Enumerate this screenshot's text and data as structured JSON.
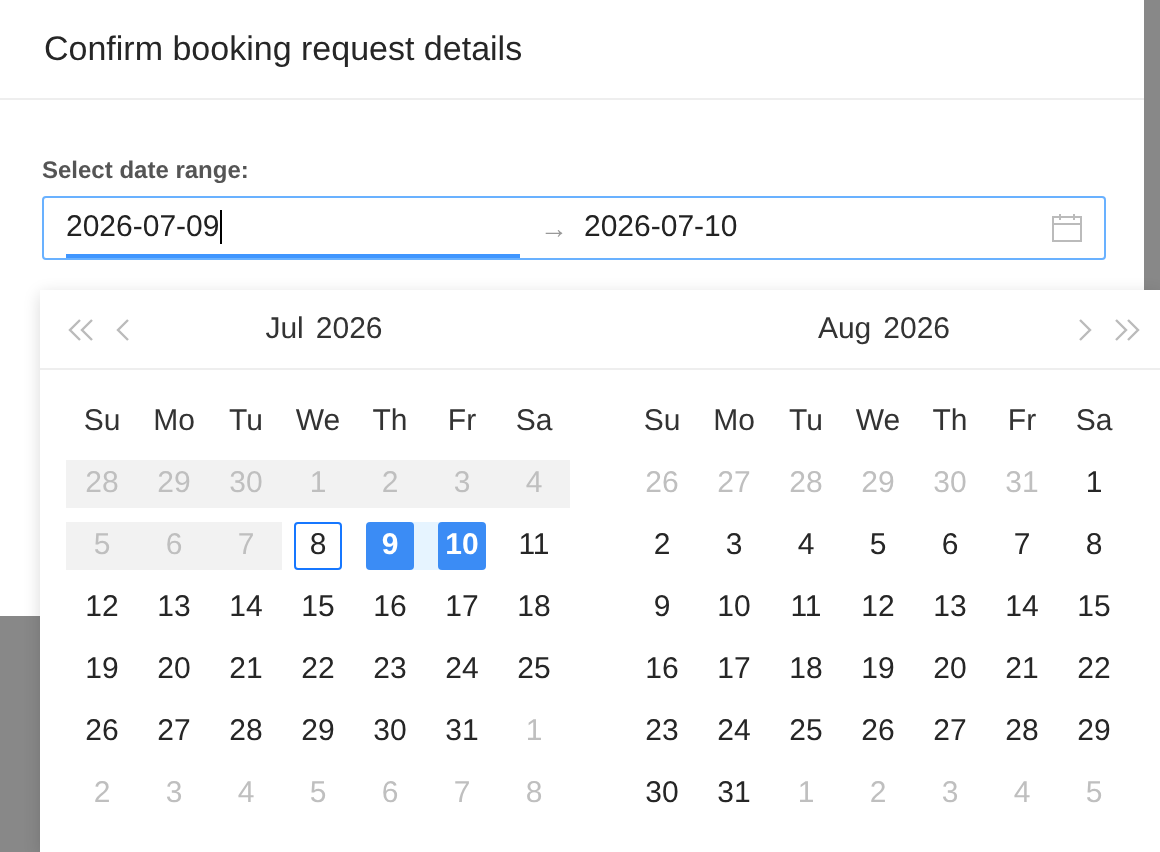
{
  "dialog": {
    "title": "Confirm booking request details"
  },
  "range_field": {
    "label": "Select date range:",
    "start": {
      "value": "2026-07-09",
      "focused": true
    },
    "separator": "→",
    "end": {
      "value": "2026-07-10",
      "focused": false
    }
  },
  "calendars": [
    {
      "month": "Jul",
      "year": "2026",
      "weekdays": [
        "Su",
        "Mo",
        "Tu",
        "We",
        "Th",
        "Fr",
        "Sa"
      ],
      "weeks": [
        [
          {
            "label": "28",
            "kind": "disabled",
            "selected": false
          },
          {
            "label": "29",
            "kind": "disabled",
            "selected": false
          },
          {
            "label": "30",
            "kind": "disabled",
            "selected": false
          },
          {
            "label": "1",
            "kind": "disabled",
            "selected": false
          },
          {
            "label": "2",
            "kind": "disabled",
            "selected": false
          },
          {
            "label": "3",
            "kind": "disabled",
            "selected": false
          },
          {
            "label": "4",
            "kind": "disabled",
            "selected": false
          }
        ],
        [
          {
            "label": "5",
            "kind": "disabled",
            "selected": false
          },
          {
            "label": "6",
            "kind": "disabled",
            "selected": false
          },
          {
            "label": "7",
            "kind": "disabled",
            "selected": false
          },
          {
            "label": "8",
            "kind": "today",
            "selected": false
          },
          {
            "label": "9",
            "kind": "normal",
            "selected": true
          },
          {
            "label": "10",
            "kind": "normal",
            "selected": true
          },
          {
            "label": "11",
            "kind": "normal",
            "selected": false
          }
        ],
        [
          {
            "label": "12",
            "kind": "normal",
            "selected": false
          },
          {
            "label": "13",
            "kind": "normal",
            "selected": false
          },
          {
            "label": "14",
            "kind": "normal",
            "selected": false
          },
          {
            "label": "15",
            "kind": "normal",
            "selected": false
          },
          {
            "label": "16",
            "kind": "normal",
            "selected": false
          },
          {
            "label": "17",
            "kind": "normal",
            "selected": false
          },
          {
            "label": "18",
            "kind": "normal",
            "selected": false
          }
        ],
        [
          {
            "label": "19",
            "kind": "normal",
            "selected": false
          },
          {
            "label": "20",
            "kind": "normal",
            "selected": false
          },
          {
            "label": "21",
            "kind": "normal",
            "selected": false
          },
          {
            "label": "22",
            "kind": "normal",
            "selected": false
          },
          {
            "label": "23",
            "kind": "normal",
            "selected": false
          },
          {
            "label": "24",
            "kind": "normal",
            "selected": false
          },
          {
            "label": "25",
            "kind": "normal",
            "selected": false
          }
        ],
        [
          {
            "label": "26",
            "kind": "normal",
            "selected": false
          },
          {
            "label": "27",
            "kind": "normal",
            "selected": false
          },
          {
            "label": "28",
            "kind": "normal",
            "selected": false
          },
          {
            "label": "29",
            "kind": "normal",
            "selected": false
          },
          {
            "label": "30",
            "kind": "normal",
            "selected": false
          },
          {
            "label": "31",
            "kind": "normal",
            "selected": false
          },
          {
            "label": "1",
            "kind": "outside",
            "selected": false
          }
        ],
        [
          {
            "label": "2",
            "kind": "outside",
            "selected": false
          },
          {
            "label": "3",
            "kind": "outside",
            "selected": false
          },
          {
            "label": "4",
            "kind": "outside",
            "selected": false
          },
          {
            "label": "5",
            "kind": "outside",
            "selected": false
          },
          {
            "label": "6",
            "kind": "outside",
            "selected": false
          },
          {
            "label": "7",
            "kind": "outside",
            "selected": false
          },
          {
            "label": "8",
            "kind": "outside",
            "selected": false
          }
        ]
      ]
    },
    {
      "month": "Aug",
      "year": "2026",
      "weekdays": [
        "Su",
        "Mo",
        "Tu",
        "We",
        "Th",
        "Fr",
        "Sa"
      ],
      "weeks": [
        [
          {
            "label": "26",
            "kind": "outside",
            "selected": false
          },
          {
            "label": "27",
            "kind": "outside",
            "selected": false
          },
          {
            "label": "28",
            "kind": "outside",
            "selected": false
          },
          {
            "label": "29",
            "kind": "outside",
            "selected": false
          },
          {
            "label": "30",
            "kind": "outside",
            "selected": false
          },
          {
            "label": "31",
            "kind": "outside",
            "selected": false
          },
          {
            "label": "1",
            "kind": "normal",
            "selected": false
          }
        ],
        [
          {
            "label": "2",
            "kind": "normal",
            "selected": false
          },
          {
            "label": "3",
            "kind": "normal",
            "selected": false
          },
          {
            "label": "4",
            "kind": "normal",
            "selected": false
          },
          {
            "label": "5",
            "kind": "normal",
            "selected": false
          },
          {
            "label": "6",
            "kind": "normal",
            "selected": false
          },
          {
            "label": "7",
            "kind": "normal",
            "selected": false
          },
          {
            "label": "8",
            "kind": "normal",
            "selected": false
          }
        ],
        [
          {
            "label": "9",
            "kind": "normal",
            "selected": false
          },
          {
            "label": "10",
            "kind": "normal",
            "selected": false
          },
          {
            "label": "11",
            "kind": "normal",
            "selected": false
          },
          {
            "label": "12",
            "kind": "normal",
            "selected": false
          },
          {
            "label": "13",
            "kind": "normal",
            "selected": false
          },
          {
            "label": "14",
            "kind": "normal",
            "selected": false
          },
          {
            "label": "15",
            "kind": "normal",
            "selected": false
          }
        ],
        [
          {
            "label": "16",
            "kind": "normal",
            "selected": false
          },
          {
            "label": "17",
            "kind": "normal",
            "selected": false
          },
          {
            "label": "18",
            "kind": "normal",
            "selected": false
          },
          {
            "label": "19",
            "kind": "normal",
            "selected": false
          },
          {
            "label": "20",
            "kind": "normal",
            "selected": false
          },
          {
            "label": "21",
            "kind": "normal",
            "selected": false
          },
          {
            "label": "22",
            "kind": "normal",
            "selected": false
          }
        ],
        [
          {
            "label": "23",
            "kind": "normal",
            "selected": false
          },
          {
            "label": "24",
            "kind": "normal",
            "selected": false
          },
          {
            "label": "25",
            "kind": "normal",
            "selected": false
          },
          {
            "label": "26",
            "kind": "normal",
            "selected": false
          },
          {
            "label": "27",
            "kind": "normal",
            "selected": false
          },
          {
            "label": "28",
            "kind": "normal",
            "selected": false
          },
          {
            "label": "29",
            "kind": "normal",
            "selected": false
          }
        ],
        [
          {
            "label": "30",
            "kind": "normal",
            "selected": false
          },
          {
            "label": "31",
            "kind": "normal",
            "selected": false
          },
          {
            "label": "1",
            "kind": "outside",
            "selected": false
          },
          {
            "label": "2",
            "kind": "outside",
            "selected": false
          },
          {
            "label": "3",
            "kind": "outside",
            "selected": false
          },
          {
            "label": "4",
            "kind": "outside",
            "selected": false
          },
          {
            "label": "5",
            "kind": "outside",
            "selected": false
          }
        ]
      ]
    }
  ]
}
